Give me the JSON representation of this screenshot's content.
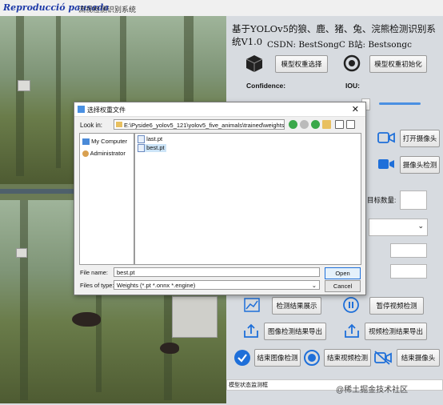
{
  "window": {
    "watermark": "Reproducció pausada",
    "title": "流视检测识别系统"
  },
  "app": {
    "title": "基于YOLOv5的狼、鹿、猪、兔、浣熊检测识别系统V1.0",
    "csdn": "CSDN:  BestSongC   B站: Bestsongc",
    "model_select": "模型权重选择",
    "model_init": "模型权重初始化",
    "confidence_label": "Confidence:",
    "iou_label": "IOU:",
    "open_camera": "打开摄像头",
    "camera_detect": "摄像头检测",
    "target_count": "目标数量:",
    "show_results": "检测结果展示",
    "pause_video": "暂停视频检测",
    "export_image": "图像检测结果导出",
    "export_video": "视频检测结果导出",
    "end_image": "结束图像检测",
    "end_video": "结束视频检测",
    "end_camera": "结束摄像头",
    "status": "模型状态监测框",
    "watermark_site": "@稀土掘金技术社区"
  },
  "dialog": {
    "title": "选择权重文件",
    "look_in_label": "Look in:",
    "path": "E:\\Pyside6_yolov5_121\\yolov5_five_animals\\trained\\weights",
    "sidebar": [
      "My Computer",
      "Administrator"
    ],
    "files": [
      "last.pt",
      "best.pt"
    ],
    "selected_file": "best.pt",
    "file_name_label": "File name:",
    "file_name_value": "best.pt",
    "file_type_label": "Files of type:",
    "file_type_value": "Weights (*.pt *.onnx *.engine)",
    "open_label": "Open",
    "cancel_label": "Cancel"
  },
  "colors": {
    "accent": "#1e6fd9",
    "slider": "#4a90e2",
    "selection": "#cce4f7"
  }
}
